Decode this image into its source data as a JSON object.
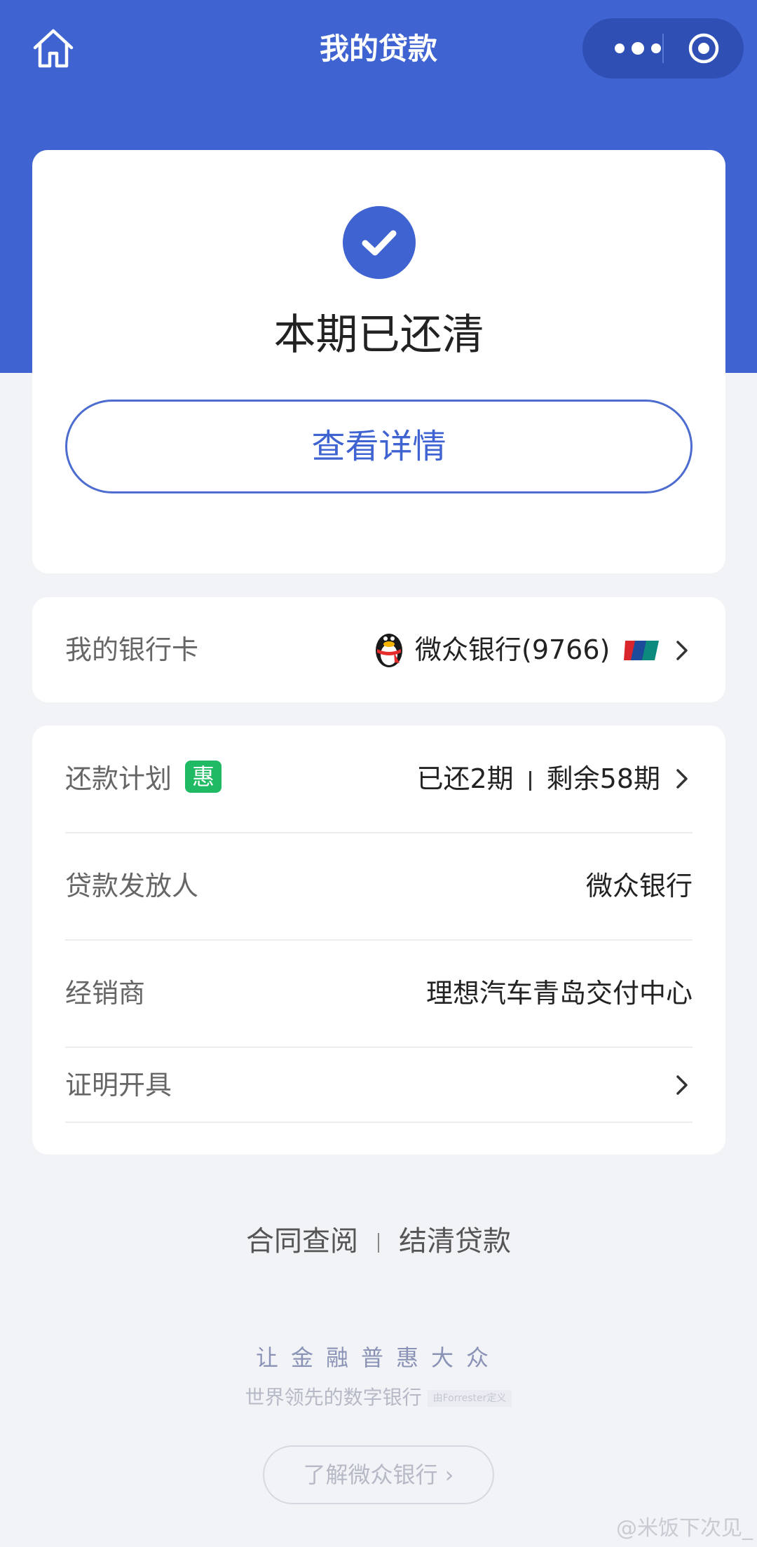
{
  "nav": {
    "title": "我的贷款",
    "home_icon": "home-icon",
    "more_icon": "more-icon",
    "target_icon": "target-icon"
  },
  "status": {
    "text": "本期已还清",
    "icon": "check-circle-icon",
    "detail_button": "查看详情"
  },
  "bank_card": {
    "label": "我的银行卡",
    "value": "微众银行(9766)",
    "logo_icon": "penguin-logo-icon",
    "network_icon": "unionpay-icon"
  },
  "info": {
    "plan": {
      "label": "还款计划",
      "badge": "惠",
      "paid": "已还2期",
      "remaining": "剩余58期"
    },
    "lender": {
      "label": "贷款发放人",
      "value": "微众银行"
    },
    "dealer": {
      "label": "经销商",
      "value": "理想汽车青岛交付中心"
    },
    "certificate": {
      "label": "证明开具"
    }
  },
  "links": {
    "contract": "合同查阅",
    "settle": "结清贷款"
  },
  "footer": {
    "slogan": "让金融普惠大众",
    "sub_slogan": "世界领先的数字银行",
    "note": "由Forrester定义",
    "know_button": "了解微众银行 ›"
  },
  "watermark": "@米饭下次见_",
  "colors": {
    "brand_blue": "#3f63d0",
    "badge_green": "#20b964",
    "page_bg": "#f2f3f7"
  }
}
